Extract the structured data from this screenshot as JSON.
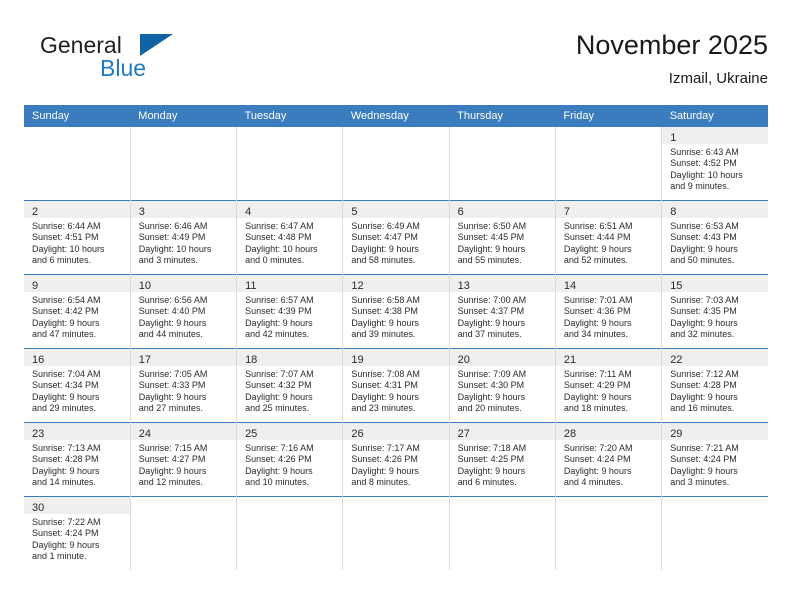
{
  "logo": {
    "word_top": "General",
    "word_bottom": "Blue",
    "flag_icon": "blue-triangle-flag-icon",
    "accent_color": "#1063a5",
    "text_color": "#1f7ac4"
  },
  "header": {
    "month_title": "November 2025",
    "location": "Izmail, Ukraine"
  },
  "theme": {
    "header_bar_color": "#3a7cbe",
    "daynum_band_color": "#efefef",
    "grid_line_color": "#dadada",
    "row_divider_color": "#3a7cbe"
  },
  "calendar": {
    "weekday_headers": [
      "Sunday",
      "Monday",
      "Tuesday",
      "Wednesday",
      "Thursday",
      "Friday",
      "Saturday"
    ],
    "weeks": [
      [
        {
          "empty": true
        },
        {
          "empty": true
        },
        {
          "empty": true
        },
        {
          "empty": true
        },
        {
          "empty": true
        },
        {
          "empty": true
        },
        {
          "day": "1",
          "sunrise": "Sunrise: 6:43 AM",
          "sunset": "Sunset: 4:52 PM",
          "daylight_line1": "Daylight: 10 hours",
          "daylight_line2": "and 9 minutes."
        }
      ],
      [
        {
          "day": "2",
          "sunrise": "Sunrise: 6:44 AM",
          "sunset": "Sunset: 4:51 PM",
          "daylight_line1": "Daylight: 10 hours",
          "daylight_line2": "and 6 minutes."
        },
        {
          "day": "3",
          "sunrise": "Sunrise: 6:46 AM",
          "sunset": "Sunset: 4:49 PM",
          "daylight_line1": "Daylight: 10 hours",
          "daylight_line2": "and 3 minutes."
        },
        {
          "day": "4",
          "sunrise": "Sunrise: 6:47 AM",
          "sunset": "Sunset: 4:48 PM",
          "daylight_line1": "Daylight: 10 hours",
          "daylight_line2": "and 0 minutes."
        },
        {
          "day": "5",
          "sunrise": "Sunrise: 6:49 AM",
          "sunset": "Sunset: 4:47 PM",
          "daylight_line1": "Daylight: 9 hours",
          "daylight_line2": "and 58 minutes."
        },
        {
          "day": "6",
          "sunrise": "Sunrise: 6:50 AM",
          "sunset": "Sunset: 4:45 PM",
          "daylight_line1": "Daylight: 9 hours",
          "daylight_line2": "and 55 minutes."
        },
        {
          "day": "7",
          "sunrise": "Sunrise: 6:51 AM",
          "sunset": "Sunset: 4:44 PM",
          "daylight_line1": "Daylight: 9 hours",
          "daylight_line2": "and 52 minutes."
        },
        {
          "day": "8",
          "sunrise": "Sunrise: 6:53 AM",
          "sunset": "Sunset: 4:43 PM",
          "daylight_line1": "Daylight: 9 hours",
          "daylight_line2": "and 50 minutes."
        }
      ],
      [
        {
          "day": "9",
          "sunrise": "Sunrise: 6:54 AM",
          "sunset": "Sunset: 4:42 PM",
          "daylight_line1": "Daylight: 9 hours",
          "daylight_line2": "and 47 minutes."
        },
        {
          "day": "10",
          "sunrise": "Sunrise: 6:56 AM",
          "sunset": "Sunset: 4:40 PM",
          "daylight_line1": "Daylight: 9 hours",
          "daylight_line2": "and 44 minutes."
        },
        {
          "day": "11",
          "sunrise": "Sunrise: 6:57 AM",
          "sunset": "Sunset: 4:39 PM",
          "daylight_line1": "Daylight: 9 hours",
          "daylight_line2": "and 42 minutes."
        },
        {
          "day": "12",
          "sunrise": "Sunrise: 6:58 AM",
          "sunset": "Sunset: 4:38 PM",
          "daylight_line1": "Daylight: 9 hours",
          "daylight_line2": "and 39 minutes."
        },
        {
          "day": "13",
          "sunrise": "Sunrise: 7:00 AM",
          "sunset": "Sunset: 4:37 PM",
          "daylight_line1": "Daylight: 9 hours",
          "daylight_line2": "and 37 minutes."
        },
        {
          "day": "14",
          "sunrise": "Sunrise: 7:01 AM",
          "sunset": "Sunset: 4:36 PM",
          "daylight_line1": "Daylight: 9 hours",
          "daylight_line2": "and 34 minutes."
        },
        {
          "day": "15",
          "sunrise": "Sunrise: 7:03 AM",
          "sunset": "Sunset: 4:35 PM",
          "daylight_line1": "Daylight: 9 hours",
          "daylight_line2": "and 32 minutes."
        }
      ],
      [
        {
          "day": "16",
          "sunrise": "Sunrise: 7:04 AM",
          "sunset": "Sunset: 4:34 PM",
          "daylight_line1": "Daylight: 9 hours",
          "daylight_line2": "and 29 minutes."
        },
        {
          "day": "17",
          "sunrise": "Sunrise: 7:05 AM",
          "sunset": "Sunset: 4:33 PM",
          "daylight_line1": "Daylight: 9 hours",
          "daylight_line2": "and 27 minutes."
        },
        {
          "day": "18",
          "sunrise": "Sunrise: 7:07 AM",
          "sunset": "Sunset: 4:32 PM",
          "daylight_line1": "Daylight: 9 hours",
          "daylight_line2": "and 25 minutes."
        },
        {
          "day": "19",
          "sunrise": "Sunrise: 7:08 AM",
          "sunset": "Sunset: 4:31 PM",
          "daylight_line1": "Daylight: 9 hours",
          "daylight_line2": "and 23 minutes."
        },
        {
          "day": "20",
          "sunrise": "Sunrise: 7:09 AM",
          "sunset": "Sunset: 4:30 PM",
          "daylight_line1": "Daylight: 9 hours",
          "daylight_line2": "and 20 minutes."
        },
        {
          "day": "21",
          "sunrise": "Sunrise: 7:11 AM",
          "sunset": "Sunset: 4:29 PM",
          "daylight_line1": "Daylight: 9 hours",
          "daylight_line2": "and 18 minutes."
        },
        {
          "day": "22",
          "sunrise": "Sunrise: 7:12 AM",
          "sunset": "Sunset: 4:28 PM",
          "daylight_line1": "Daylight: 9 hours",
          "daylight_line2": "and 16 minutes."
        }
      ],
      [
        {
          "day": "23",
          "sunrise": "Sunrise: 7:13 AM",
          "sunset": "Sunset: 4:28 PM",
          "daylight_line1": "Daylight: 9 hours",
          "daylight_line2": "and 14 minutes."
        },
        {
          "day": "24",
          "sunrise": "Sunrise: 7:15 AM",
          "sunset": "Sunset: 4:27 PM",
          "daylight_line1": "Daylight: 9 hours",
          "daylight_line2": "and 12 minutes."
        },
        {
          "day": "25",
          "sunrise": "Sunrise: 7:16 AM",
          "sunset": "Sunset: 4:26 PM",
          "daylight_line1": "Daylight: 9 hours",
          "daylight_line2": "and 10 minutes."
        },
        {
          "day": "26",
          "sunrise": "Sunrise: 7:17 AM",
          "sunset": "Sunset: 4:26 PM",
          "daylight_line1": "Daylight: 9 hours",
          "daylight_line2": "and 8 minutes."
        },
        {
          "day": "27",
          "sunrise": "Sunrise: 7:18 AM",
          "sunset": "Sunset: 4:25 PM",
          "daylight_line1": "Daylight: 9 hours",
          "daylight_line2": "and 6 minutes."
        },
        {
          "day": "28",
          "sunrise": "Sunrise: 7:20 AM",
          "sunset": "Sunset: 4:24 PM",
          "daylight_line1": "Daylight: 9 hours",
          "daylight_line2": "and 4 minutes."
        },
        {
          "day": "29",
          "sunrise": "Sunrise: 7:21 AM",
          "sunset": "Sunset: 4:24 PM",
          "daylight_line1": "Daylight: 9 hours",
          "daylight_line2": "and 3 minutes."
        }
      ],
      [
        {
          "day": "30",
          "sunrise": "Sunrise: 7:22 AM",
          "sunset": "Sunset: 4:24 PM",
          "daylight_line1": "Daylight: 9 hours",
          "daylight_line2": "and 1 minute."
        },
        {
          "empty": true
        },
        {
          "empty": true
        },
        {
          "empty": true
        },
        {
          "empty": true
        },
        {
          "empty": true
        },
        {
          "empty": true
        }
      ]
    ]
  }
}
